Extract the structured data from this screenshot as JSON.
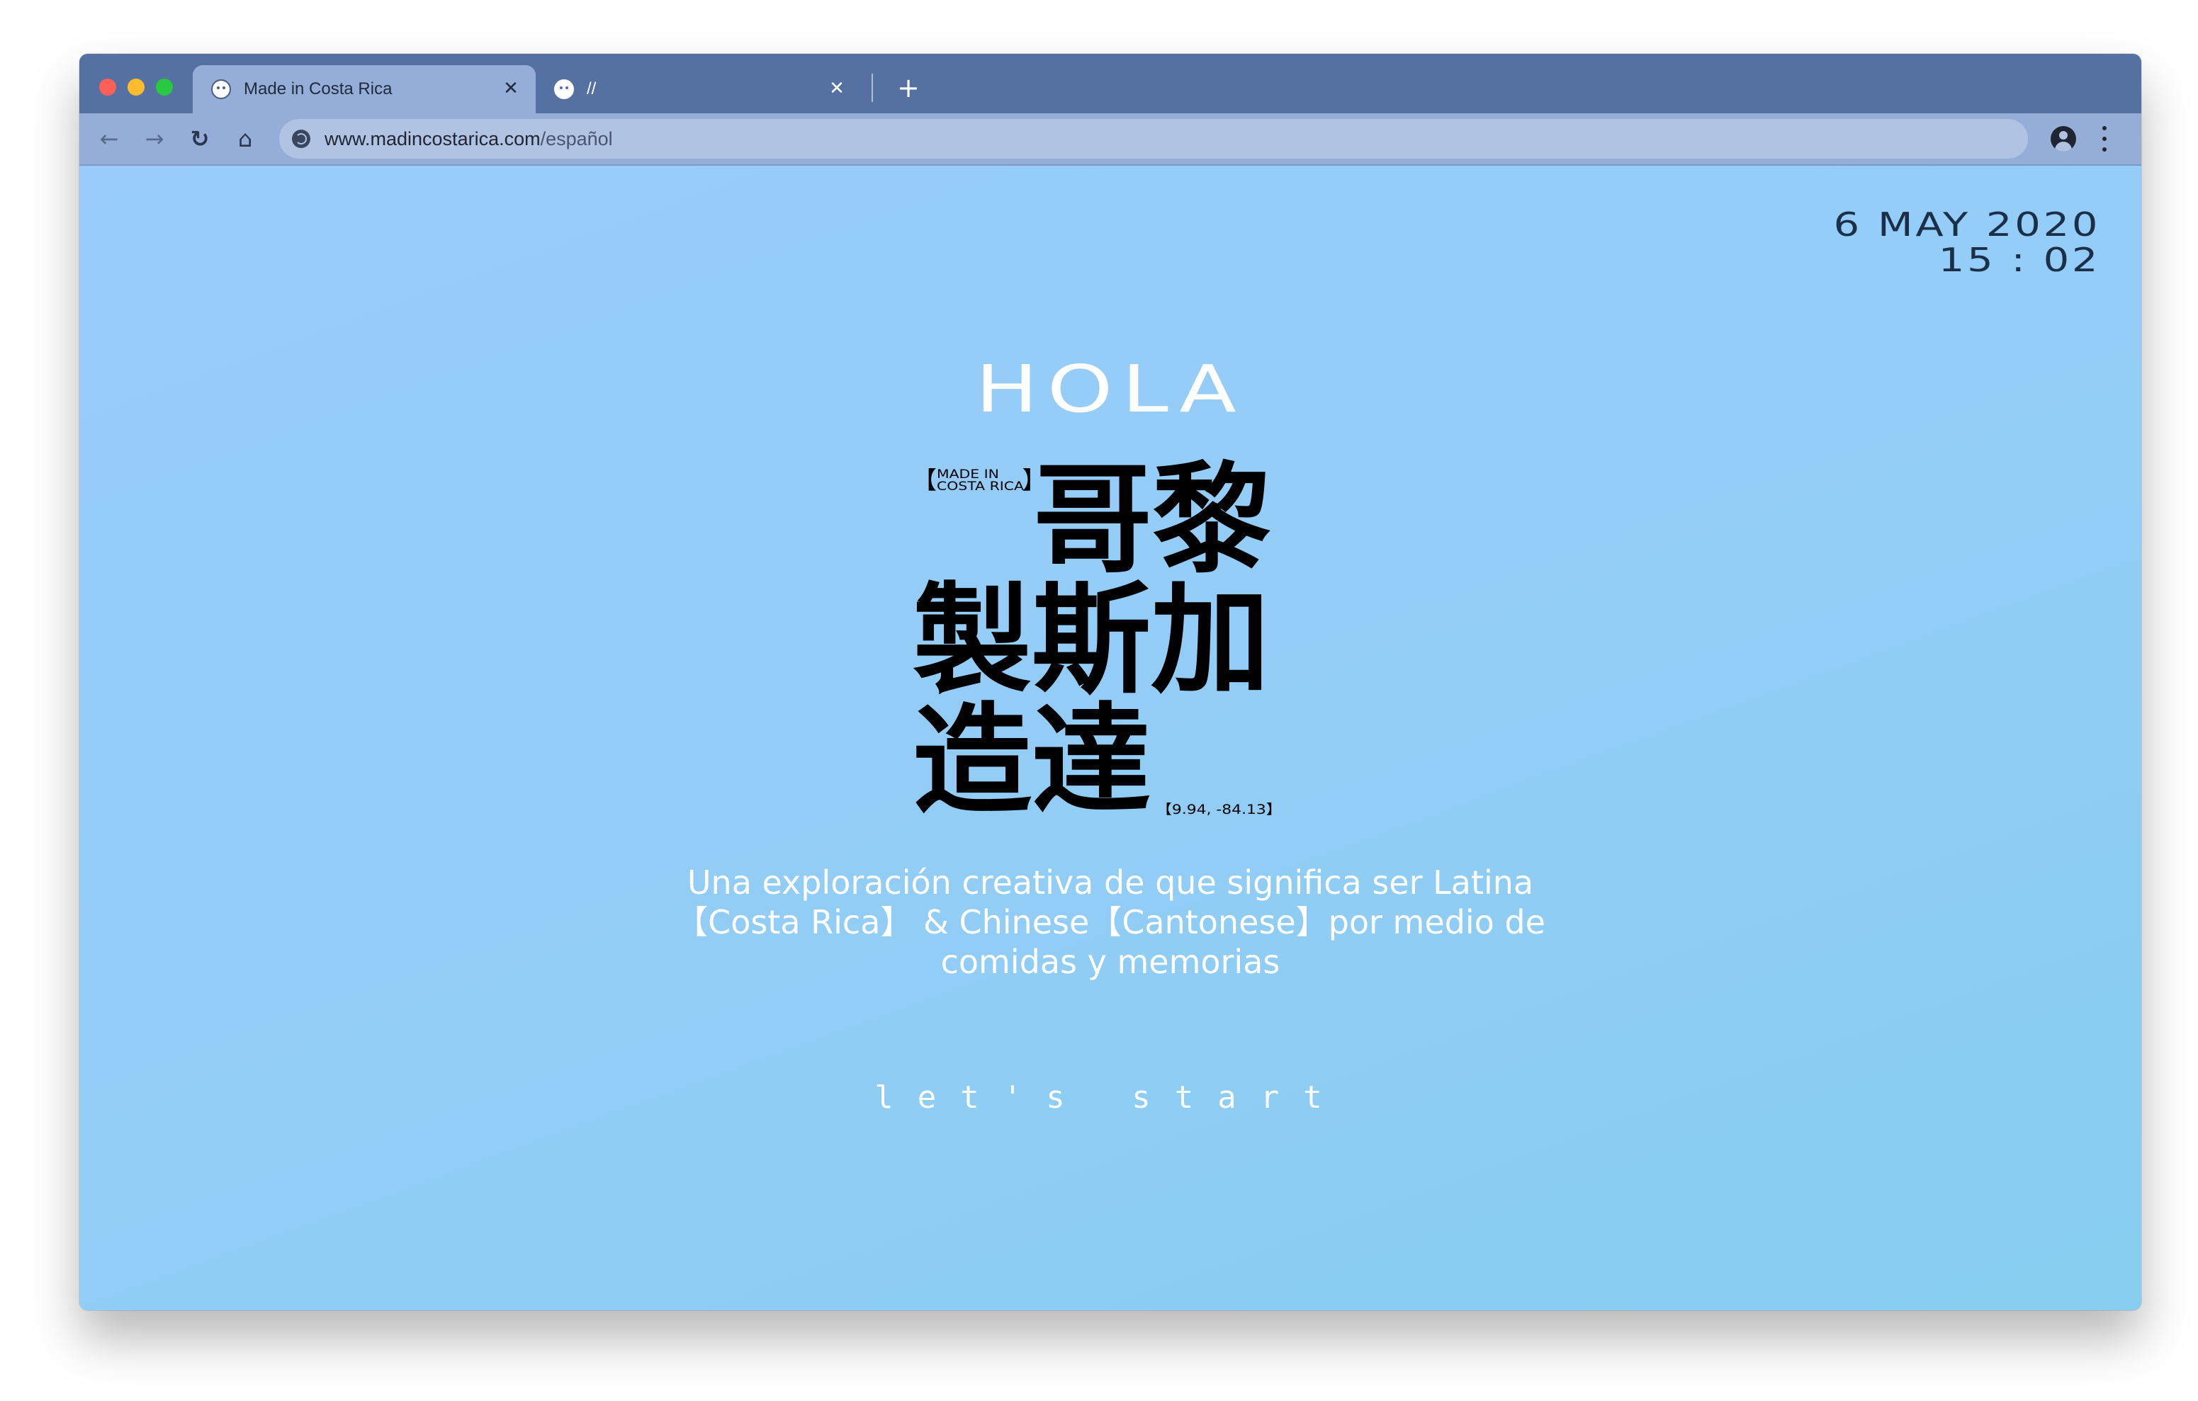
{
  "browser": {
    "tabs": [
      {
        "title": "Made in Costa Rica",
        "active": true,
        "icon": "smiley-favicon-icon"
      },
      {
        "title": "//",
        "active": false,
        "icon": "smiley-favicon-icon"
      }
    ],
    "tab_close_glyph": "✕",
    "new_tab_glyph": "+",
    "nav": {
      "back_glyph": "←",
      "forward_glyph": "→",
      "reload_glyph": "↻",
      "home_glyph": "⌂"
    },
    "url": {
      "host": "www.madincostarica.com",
      "path": "/español"
    },
    "colors": {
      "tabstrip": "#5471a2",
      "active_tab": "#94aed7",
      "omnibox": "#b0c3e3"
    }
  },
  "page": {
    "date": "6 MAY 2020",
    "time": "15 : 02",
    "greeting": "HOLA",
    "logo": {
      "tag_line1": "MADE IN",
      "tag_line2": "COSTA RICA",
      "han_row1": "哥黎",
      "han_row2": "製斯加",
      "han_row3": "造達",
      "coordinates": "【9.94, -84.13】"
    },
    "tagline": {
      "line1": "Una exploración creativa de que significa ser Latina",
      "line2": "【Costa Rica】 & Chinese【Cantonese】por medio de",
      "line3": "comidas y memorias"
    },
    "cta": "let's start",
    "colors": {
      "background": "#95cdf7",
      "text_light": "#ffffff",
      "text_dark": "#1c2f48"
    }
  }
}
